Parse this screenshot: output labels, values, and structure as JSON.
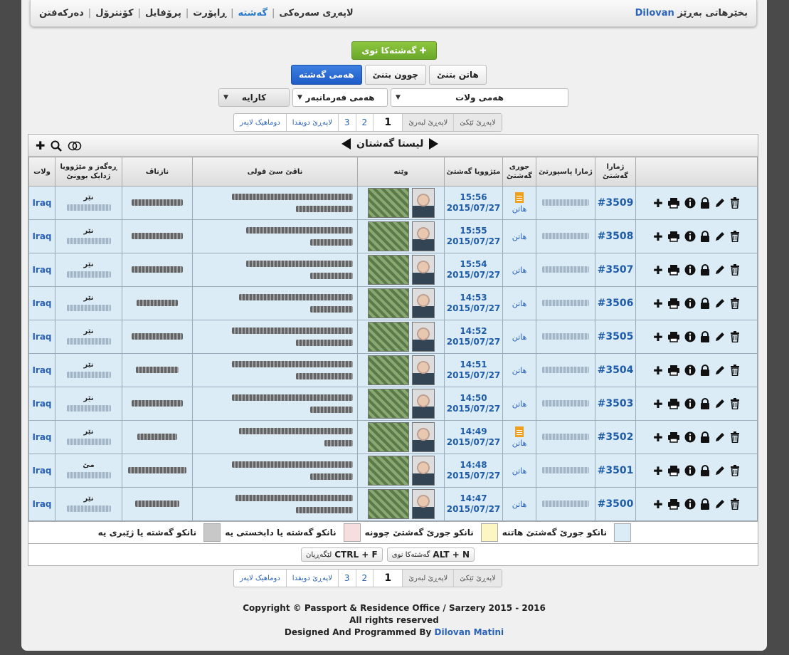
{
  "nav": {
    "welcome_prefix": "بخێرهاتی بەڕێز",
    "username": "Dilovan",
    "links": [
      "لاپەڕی سەرەکی",
      "گەشتە",
      "ڕاپۆرت",
      "پرۆفایل",
      "کۆنترۆل",
      "دەرکەفتن"
    ]
  },
  "buttons": {
    "new_trip": "گەشتەکا نوی",
    "arrival": "هاتن بتنێ",
    "departure": "چوون بتنێ",
    "all_trips": "هەمی گەشتە"
  },
  "filters": {
    "country": "هەمی ولات",
    "commander": "هەمی فەرمانبەر",
    "action": "کارایە"
  },
  "pager": {
    "last_page": "دوماهیک لاپەر",
    "next_page": "لاپەڕێ دویفدا",
    "pages": [
      "3",
      "2"
    ],
    "current": "1",
    "prev_page": "لاپەڕێ لبەرێ",
    "first_page": "لاپەڕێ ئێکێ"
  },
  "panel": {
    "title": "لیستا گەشتان"
  },
  "table": {
    "headers": {
      "visa_number": "ژمارا گەشتێ",
      "passport_number": "ژمارا پاسپورتێ",
      "type": "جوری گەشتێ",
      "date": "مێژوویا گەشتێ",
      "photo": "وێنە",
      "full_name": "ناڤێ سێ قولی",
      "nickname": "نازناڤ",
      "birthdate": "ڕەگەز و مێژوویا ژدایک بوونێ",
      "country": "ولات"
    },
    "rows": [
      {
        "visa": "#3509",
        "type": "هاتن",
        "doc": true,
        "time": "15:56",
        "date": "2015/07/27",
        "gender": "نێر",
        "country": "Iraq"
      },
      {
        "visa": "#3508",
        "type": "هاتن",
        "doc": false,
        "time": "15:55",
        "date": "2015/07/27",
        "gender": "نێر",
        "country": "Iraq"
      },
      {
        "visa": "#3507",
        "type": "هاتن",
        "doc": false,
        "time": "15:54",
        "date": "2015/07/27",
        "gender": "نێر",
        "country": "Iraq"
      },
      {
        "visa": "#3506",
        "type": "هاتن",
        "doc": false,
        "time": "14:53",
        "date": "2015/07/27",
        "gender": "نێر",
        "country": "Iraq"
      },
      {
        "visa": "#3505",
        "type": "هاتن",
        "doc": false,
        "time": "14:52",
        "date": "2015/07/27",
        "gender": "نێر",
        "country": "Iraq"
      },
      {
        "visa": "#3504",
        "type": "هاتن",
        "doc": false,
        "time": "14:51",
        "date": "2015/07/27",
        "gender": "نێر",
        "country": "Iraq"
      },
      {
        "visa": "#3503",
        "type": "هاتن",
        "doc": false,
        "time": "14:50",
        "date": "2015/07/27",
        "gender": "نێر",
        "country": "Iraq"
      },
      {
        "visa": "#3502",
        "type": "هاتن",
        "doc": true,
        "time": "14:49",
        "date": "2015/07/27",
        "gender": "نێر",
        "country": "Iraq"
      },
      {
        "visa": "#3501",
        "type": "هاتن",
        "doc": false,
        "time": "14:48",
        "date": "2015/07/27",
        "gender": "مێ",
        "country": "Iraq"
      },
      {
        "visa": "#3500",
        "type": "هاتن",
        "doc": false,
        "time": "14:47",
        "date": "2015/07/27",
        "gender": "نێر",
        "country": "Iraq"
      }
    ]
  },
  "legend": [
    {
      "label": "نانکو جورێ گەشتێ هاتنە",
      "color": "#dcecf7"
    },
    {
      "label": "نانکو جورێ گەشتێ چوونە",
      "color": "#fdf6c3"
    },
    {
      "label": "نانکو گەشتە یا دابخستی یە",
      "color": "#f6dede"
    },
    {
      "label": "نانکو گەشتە یا ژێبری یە",
      "color": "#c8c8c8"
    }
  ],
  "shortcuts": [
    {
      "keys": "ALT + N",
      "label": "گەشتەکا نوی"
    },
    {
      "keys": "CTRL + F",
      "label": "لێگەڕیان"
    }
  ],
  "footer": {
    "line1": "Copyright © Passport & Residence Office / Sarzery 2015 - 2016",
    "line2": "All rights reserved",
    "line3_prefix": "Designed And Programmed By",
    "author": "Dilovan Matini"
  }
}
